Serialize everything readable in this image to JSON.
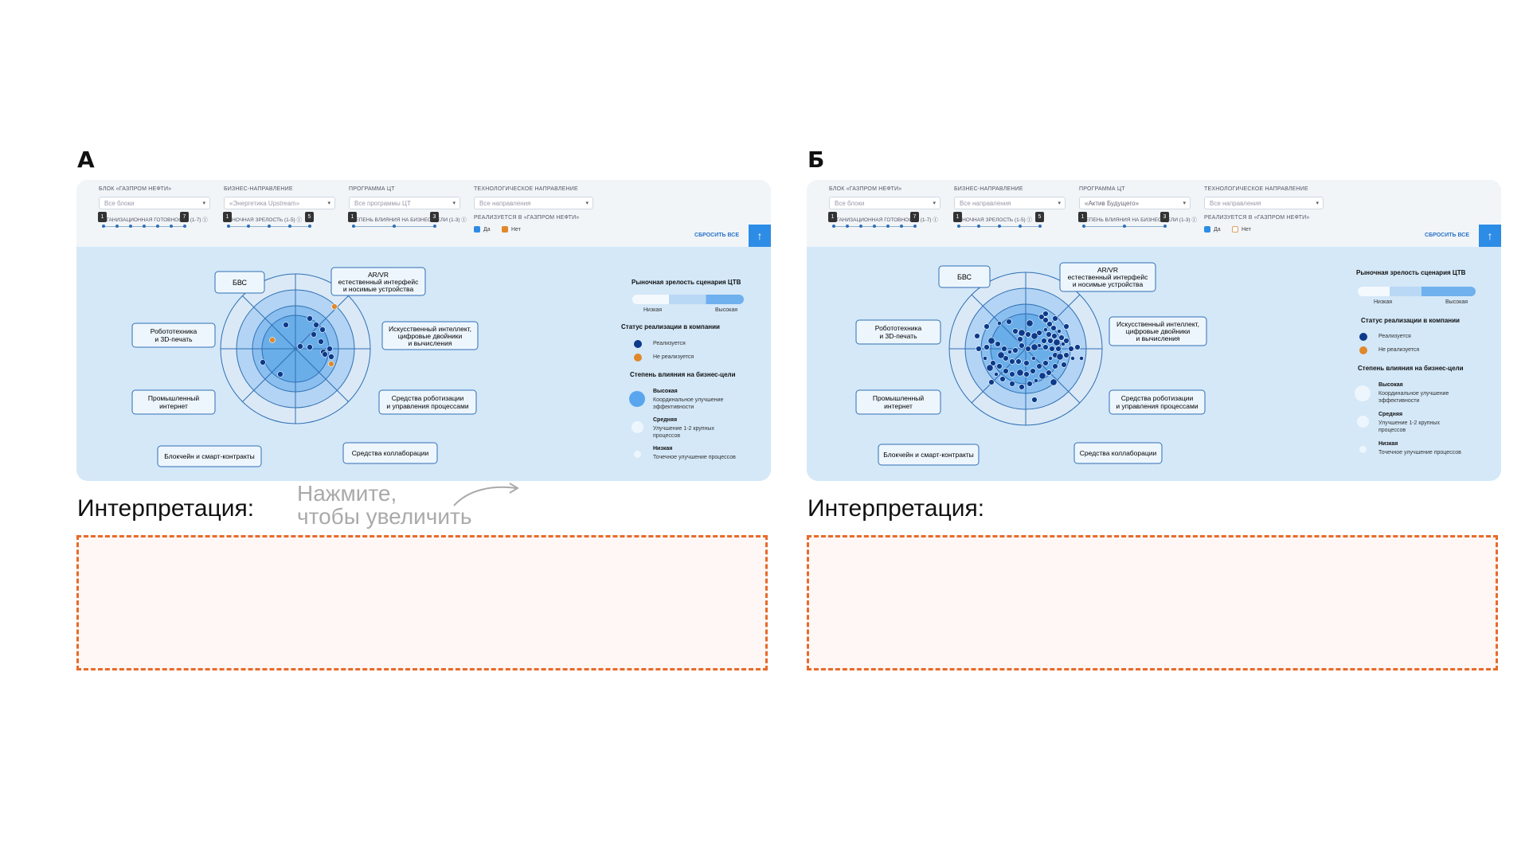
{
  "panel_a": {
    "letter": "А",
    "filters": {
      "block_label": "БЛОК «ГАЗПРОМ НЕФТИ»",
      "block_value": "Все блоки",
      "direction_label": "БИЗНЕС-НАПРАВЛЕНИЕ",
      "direction_value": "«Энергетика Upstream»",
      "program_label": "ПРОГРАММА ЦТ",
      "program_value": "Все программы ЦТ",
      "tech_label": "ТЕХНОЛОГИЧЕСКОЕ НАПРАВЛЕНИЕ",
      "tech_value": "Все направления",
      "slider1_label": "ОРГАНИЗАЦИОННАЯ ГОТОВНОСТЬ (1-7) ⓘ",
      "slider1_min": "1",
      "slider1_max": "7",
      "slider2_label": "РЫНОЧНАЯ ЗРЕЛОСТЬ (1-5) ⓘ",
      "slider2_min": "1",
      "slider2_max": "5",
      "slider3_label": "СТЕПЕНЬ ВЛИЯНИЯ НА БИЗНЕС-ЦЕЛИ (1-3) ⓘ",
      "slider3_min": "1",
      "slider3_max": "3",
      "implemented_label": "РЕАЛИЗУЕТСЯ В «ГАЗПРОМ НЕФТИ»",
      "yes": "Да",
      "no": "Нет",
      "reset": "СБРОСИТЬ ВСЕ",
      "up_icon": "arrow-up-icon"
    },
    "labels": {
      "bvs": "БВС",
      "arvr": [
        "AR/VR",
        "естественный интерфейс",
        "и носимые устройства"
      ],
      "ai": [
        "Искусственный интеллект,",
        "цифровые двойники",
        "и вычисления"
      ],
      "robo": [
        "Средства роботизации",
        "и управления процессами"
      ],
      "collab": "Средства коллаборации",
      "chain": "Блокчейн и смарт-контракты",
      "iot": [
        "Промышленный",
        "интернет"
      ],
      "r3d": [
        "Робототехника",
        "и 3D-печать"
      ]
    },
    "legend": {
      "maturity": "Рыночная зрелость сценария ЦТВ",
      "low": "Низкая",
      "high": "Высокая",
      "status": "Статус реализации в компании",
      "implemented": "Реализуется",
      "not_implemented": "Не реализуется",
      "impact": "Степень влияния на бизнес-цели",
      "impact_high": "Высокая",
      "impact_high_desc": [
        "Координальное улучшение",
        "эффективности"
      ],
      "impact_mid": "Средняя",
      "impact_mid_desc": [
        "Улучшение 1-2 крупных",
        "процессов"
      ],
      "impact_low": "Низкая",
      "impact_low_desc": [
        "Точечное улучшение процессов"
      ]
    },
    "interpretation": "Интерпретация:",
    "hint": [
      "Нажмите,",
      "чтобы увеличить"
    ]
  },
  "panel_b": {
    "letter": "Б",
    "filters": {
      "block_label": "БЛОК «ГАЗПРОМ НЕФТИ»",
      "block_value": "Все блоки",
      "direction_label": "БИЗНЕС-НАПРАВЛЕНИЕ",
      "direction_value": "Все направления",
      "program_label": "ПРОГРАММА ЦТ",
      "program_value": "«Актив Будущего»",
      "tech_label": "ТЕХНОЛОГИЧЕСКОЕ НАПРАВЛЕНИЕ",
      "tech_value": "Все направления",
      "slider1_label": "ОРГАНИЗАЦИОННАЯ ГОТОВНОСТЬ (1-7) ⓘ",
      "slider1_min": "1",
      "slider1_max": "7",
      "slider2_label": "РЫНОЧНАЯ ЗРЕЛОСТЬ (1-5) ⓘ",
      "slider2_min": "1",
      "slider2_max": "5",
      "slider3_label": "СТЕПЕНЬ ВЛИЯНИЯ НА БИЗНЕС-ЦЕЛИ (1-3) ⓘ",
      "slider3_min": "1",
      "slider3_max": "3",
      "implemented_label": "РЕАЛИЗУЕТСЯ В «ГАЗПРОМ НЕФТИ»",
      "yes": "Да",
      "no": "Нет",
      "reset": "СБРОСИТЬ ВСЕ",
      "up_icon": "arrow-up-icon"
    },
    "labels": {
      "bvs": "БВС",
      "arvr": [
        "AR/VR",
        "естественный интерфейс",
        "и носимые устройства"
      ],
      "ai": [
        "Искусственный интеллект,",
        "цифровые двойники",
        "и вычисления"
      ],
      "robo": [
        "Средства роботизации",
        "и управления процессами"
      ],
      "collab": "Средства коллаборации",
      "chain": "Блокчейн и смарт-контракты",
      "iot": [
        "Промышленный",
        "интернет"
      ],
      "r3d": [
        "Робототехника",
        "и 3D-печать"
      ]
    },
    "legend": {
      "maturity": "Рыночная зрелость сценария ЦТВ",
      "low": "Низкая",
      "high": "Высокая",
      "status": "Статус реализации в компании",
      "implemented": "Реализуется",
      "not_implemented": "Не реализуется",
      "impact": "Степень влияния на бизнес-цели",
      "impact_high": "Высокая",
      "impact_high_desc": [
        "Координальное улучшение",
        "эффективности"
      ],
      "impact_mid": "Средняя",
      "impact_mid_desc": [
        "Улучшение 1-2 крупных",
        "процессов"
      ],
      "impact_low": "Низкая",
      "impact_low_desc": [
        "Точечное улучшение процессов"
      ]
    },
    "interpretation": "Интерпретация:"
  },
  "colors": {
    "implemented": "#0d3a8a",
    "not_implemented": "#e0882a",
    "accent": "#2d8ce6",
    "dashed": "#e86a2a"
  }
}
